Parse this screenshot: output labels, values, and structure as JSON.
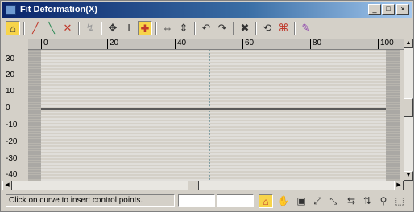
{
  "window": {
    "title": "Fit Deformation(X)",
    "controls": {
      "minimize": "_",
      "maximize": "□",
      "close": "×"
    }
  },
  "toolbar": {
    "items": [
      {
        "name": "lock-selection-tool",
        "glyph": "⌂",
        "active": true
      },
      {
        "name": "y-curve-toggle",
        "glyph": "╱",
        "active": false
      },
      {
        "name": "x-curve-toggle",
        "glyph": "╲",
        "active": false
      },
      {
        "name": "both-curves-toggle",
        "glyph": "✕",
        "active": false
      },
      {
        "name": "swap-curves-tool",
        "glyph": "↯",
        "active": false
      },
      {
        "name": "move-control-point-tool",
        "glyph": "✥",
        "active": false
      },
      {
        "name": "scale-control-point-tool",
        "glyph": "I",
        "active": false
      },
      {
        "name": "insert-corner-point-tool",
        "glyph": "✚",
        "active": true
      },
      {
        "name": "mirror-horizontal-tool",
        "glyph": "⇔",
        "active": false
      },
      {
        "name": "mirror-vertical-tool",
        "glyph": "⇕",
        "active": false
      },
      {
        "name": "rotate-ccw-tool",
        "glyph": "↶",
        "active": false
      },
      {
        "name": "rotate-cw-tool",
        "glyph": "↷",
        "active": false
      },
      {
        "name": "delete-control-point-tool",
        "glyph": "✖",
        "active": false
      },
      {
        "name": "reset-curve-tool",
        "glyph": "⟲",
        "active": false
      },
      {
        "name": "get-shape-tool",
        "glyph": "⌘",
        "active": false
      },
      {
        "name": "generate-path-tool",
        "glyph": "✎",
        "active": false
      }
    ]
  },
  "ruler": {
    "labels": [
      "0",
      "20",
      "40",
      "60",
      "80",
      "100"
    ]
  },
  "graph": {
    "y_labels": [
      "30",
      "20",
      "10",
      "0",
      "-10",
      "-20",
      "-30",
      "-40"
    ],
    "colors": {
      "background": "#d4d0c8",
      "gridline": "#ebebeb",
      "curve": "#5a5a5a",
      "marker": "#2f6a78",
      "edge_stripes": "#9b9b9b"
    }
  },
  "status": {
    "message": "Click on curve to insert control points.",
    "field1": "",
    "field2": ""
  },
  "status_tools": [
    {
      "name": "lock-tool",
      "glyph": "⌂",
      "active": true
    },
    {
      "name": "pan-tool",
      "glyph": "✋",
      "active": false
    },
    {
      "name": "zoom-extents-tool",
      "glyph": "▣",
      "active": false
    },
    {
      "name": "zoom-horizontal-extents-tool",
      "glyph": "⤢",
      "active": false
    },
    {
      "name": "zoom-vertical-extents-tool",
      "glyph": "⤡",
      "active": false
    },
    {
      "name": "zoom-horizontal-tool",
      "glyph": "⇆",
      "active": false
    },
    {
      "name": "zoom-vertical-tool",
      "glyph": "⇅",
      "active": false
    },
    {
      "name": "zoom-tool",
      "glyph": "⚲",
      "active": false
    },
    {
      "name": "zoom-region-tool",
      "glyph": "⬚",
      "active": false
    }
  ]
}
